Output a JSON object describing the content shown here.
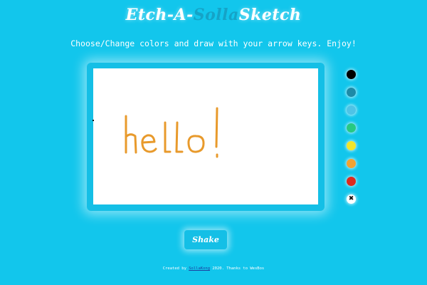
{
  "header": {
    "title_part1": "Etch-A-",
    "title_part2": "Solla",
    "title_part3": "Sketch",
    "subtitle": "Choose/Change colors and draw with your arrow keys. Enjoy!"
  },
  "canvas": {
    "drawing_text": "hello!",
    "stroke_color": "#e89a2c"
  },
  "palette": {
    "colors": [
      "#000000",
      "#1e8aa6",
      "#4ec3e6",
      "#27c983",
      "#f2e52a",
      "#f2a232",
      "#dd2a1f"
    ],
    "clear_label": "✖",
    "clear_icon": "close-icon"
  },
  "shake_button": {
    "label": "Shake"
  },
  "footer": {
    "prefix": "Created by ",
    "link": "SollaKong",
    "suffix": " 2020. Thanks to WesBos"
  },
  "colors": {
    "background": "#12c6ec",
    "title_accent": "#15a3c7"
  }
}
